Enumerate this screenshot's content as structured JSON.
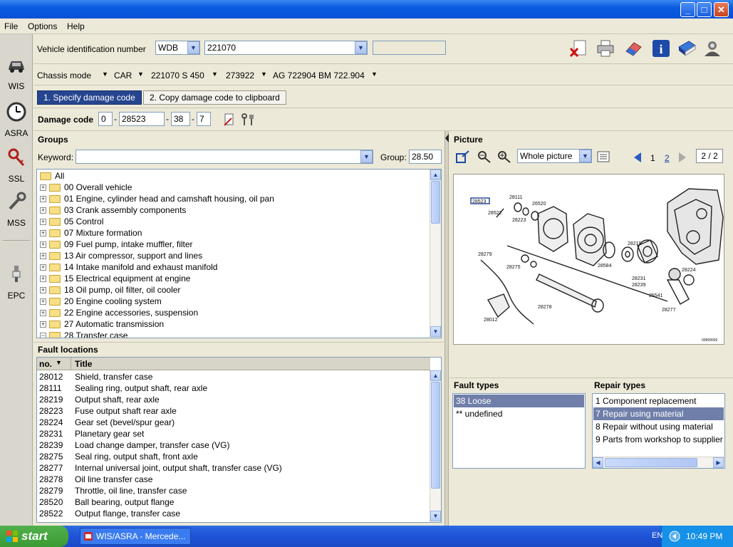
{
  "window": {
    "minimize": "_",
    "maximize": "□",
    "close": "✕"
  },
  "menu": [
    "File",
    "Options",
    "Help"
  ],
  "nav": [
    {
      "label": "WIS",
      "icon": "car-icon",
      "glyph": "🚗"
    },
    {
      "label": "ASRA",
      "icon": "stopwatch-icon",
      "glyph": "⏱"
    },
    {
      "label": "SSL",
      "icon": "key-icon",
      "glyph": "🔑"
    },
    {
      "label": "MSS",
      "icon": "wrench-icon",
      "glyph": "🔧"
    },
    {
      "label": "EPC",
      "icon": "spark-plug-icon",
      "glyph": "⚡"
    }
  ],
  "vin": {
    "label": "Vehicle identification number",
    "prefix": "WDB",
    "value": "221070",
    "extra": ""
  },
  "toolbar_icons": [
    "delete-document-icon",
    "printer-icon",
    "eraser-icon",
    "info-icon",
    "book-icon",
    "user-settings-icon"
  ],
  "chassis": {
    "label": "Chassis mode",
    "items": [
      "CAR",
      "221070 S 450",
      "273922",
      "AG 722904 BM 722.904"
    ]
  },
  "tabs": {
    "tab1": "1. Specify damage code",
    "tab2": "2. Copy damage code to clipboard"
  },
  "damage": {
    "label": "Damage code",
    "f1": "0",
    "f2": "28523",
    "f3": "38",
    "f4": "7",
    "sep": "-"
  },
  "groups": {
    "title": "Groups",
    "keyword_label": "Keyword:",
    "keyword_value": "",
    "group_label": "Group:",
    "group_value": "28.50",
    "root": "All",
    "items": [
      "00  Overall vehicle",
      "01  Engine, cylinder head and camshaft housing, oil pan",
      "03  Crank assembly components",
      "05  Control",
      "07  Mixture formation",
      "09  Fuel pump, intake muffler, filter",
      "13  Air compressor, support and lines",
      "14  Intake manifold and exhaust manifold",
      "15  Electrical equipment at engine",
      "18  Oil pump, oil filter, oil cooler",
      "20  Engine cooling system",
      "22  Engine accessories, suspension",
      "27  Automatic transmission",
      "28  Transfer case"
    ]
  },
  "fault_locations": {
    "title": "Fault locations",
    "col_no": "no.",
    "col_title": "Title",
    "rows": [
      {
        "no": "28012",
        "title": "Shield, transfer case"
      },
      {
        "no": "28111",
        "title": "Sealing ring, output shaft, rear axle"
      },
      {
        "no": "28219",
        "title": "Output shaft, rear axle"
      },
      {
        "no": "28223",
        "title": "Fuse output shaft rear axle"
      },
      {
        "no": "28224",
        "title": "Gear set (bevel/spur gear)"
      },
      {
        "no": "28231",
        "title": "Planetary gear set"
      },
      {
        "no": "28239",
        "title": "Load change damper, transfer case (VG)"
      },
      {
        "no": "28275",
        "title": "Seal ring, output shaft, front axle"
      },
      {
        "no": "28277",
        "title": "Internal universal joint, output shaft, transfer case (VG)"
      },
      {
        "no": "28278",
        "title": "Oil line transfer case"
      },
      {
        "no": "28279",
        "title": "Throttle, oil line, transfer case"
      },
      {
        "no": "28520",
        "title": "Ball bearing, output flange"
      },
      {
        "no": "28522",
        "title": "Output flange, transfer case"
      }
    ]
  },
  "picture": {
    "title": "Picture",
    "view": "Whole picture",
    "page1": "1",
    "page2": "2",
    "page_count": "2 / 2",
    "drawing_id": "00899006",
    "parts": [
      "28523",
      "28111",
      "26520",
      "28522",
      "28223",
      "28279",
      "28275",
      "28584",
      "28219",
      "28224",
      "28231",
      "28239",
      "25541",
      "28277",
      "28278",
      "28012"
    ]
  },
  "fault_types": {
    "title": "Fault types",
    "items": [
      "38  Loose",
      "**  undefined"
    ],
    "selected": 0
  },
  "repair_types": {
    "title": "Repair types",
    "items": [
      "1  Component replacement",
      "7  Repair using material",
      "8  Repair without using material",
      "9  Parts from workshop to supplier"
    ],
    "selected": 1
  },
  "taskbar": {
    "start": "start",
    "task": "WIS/ASRA - Mercede...",
    "lang": "EN",
    "clock": "10:49 PM"
  }
}
